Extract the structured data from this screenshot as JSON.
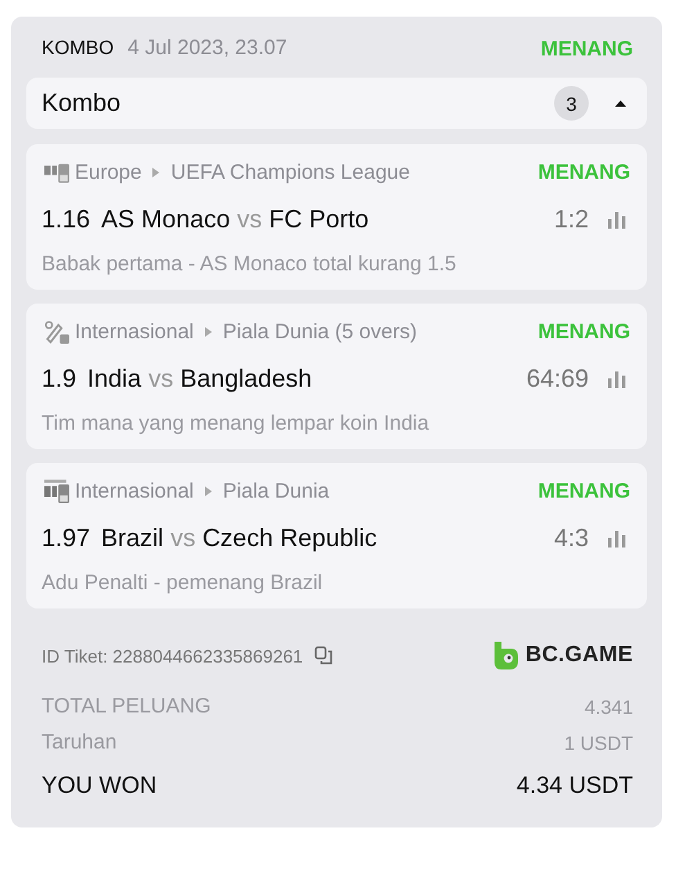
{
  "header": {
    "type": "KOMBO",
    "date": "4 Jul 2023, 23.07",
    "status": "MENANG"
  },
  "group": {
    "title": "Kombo",
    "count": "3",
    "expanded": true
  },
  "bets": [
    {
      "kind": "fifa",
      "region": "Europe",
      "league": "UEFA Champions League",
      "status": "MENANG",
      "odds": "1.16",
      "home": "AS Monaco",
      "vs": "vs",
      "away": "FC Porto",
      "score": "1:2",
      "market": "Babak pertama - AS Monaco total kurang 1.5"
    },
    {
      "kind": "cricket",
      "region": "Internasional",
      "league": "Piala Dunia (5 overs)",
      "status": "MENANG",
      "odds": "1.9",
      "home": "India",
      "vs": "vs",
      "away": "Bangladesh",
      "score": "64:69",
      "market": "Tim mana yang menang lempar koin India"
    },
    {
      "kind": "penalty",
      "region": "Internasional",
      "league": "Piala Dunia",
      "status": "MENANG",
      "odds": "1.97",
      "home": "Brazil",
      "vs": "vs",
      "away": "Czech Republic",
      "score": "4:3",
      "market": "Adu Penalti - pemenang Brazil"
    }
  ],
  "ticket": {
    "id": "ID Tiket: 2288044662335869261",
    "brand": "BC.GAME"
  },
  "summary": [
    {
      "label": "TOTAL PELUANG",
      "value": "4.341",
      "kind": "muted"
    },
    {
      "label": "Taruhan",
      "value": "1 USDT",
      "kind": "muted"
    },
    {
      "label": "YOU WON",
      "value": "4.34 USDT",
      "kind": "strong"
    }
  ]
}
